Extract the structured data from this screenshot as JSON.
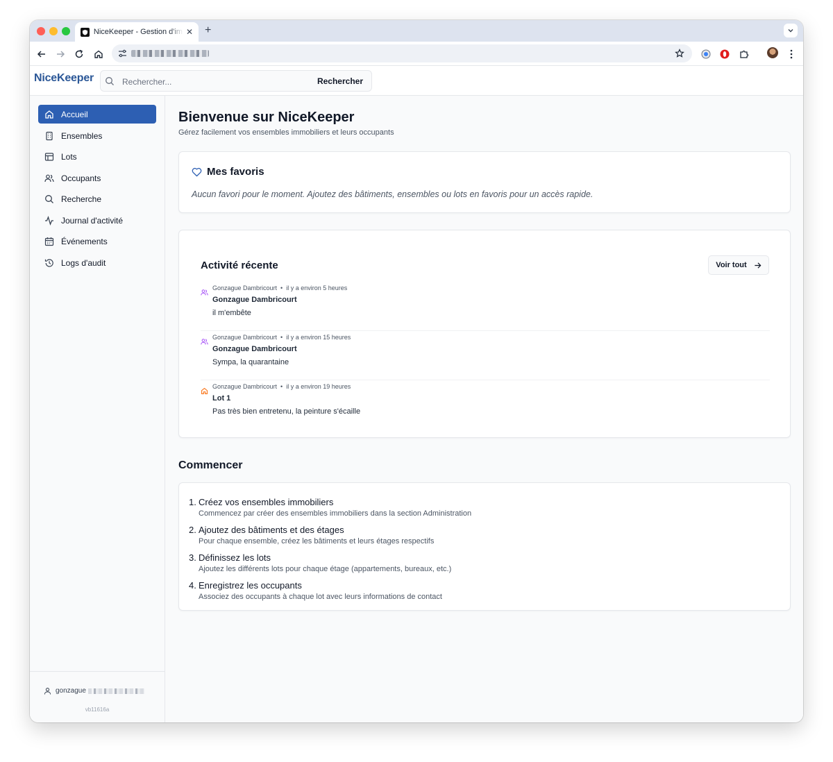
{
  "browser": {
    "tab_title": "NiceKeeper - Gestion d'immeubles",
    "tab_close": "✕",
    "new_tab": "+"
  },
  "app": {
    "brand": "NiceKeeper",
    "search": {
      "placeholder": "Rechercher...",
      "button": "Rechercher"
    }
  },
  "sidebar": {
    "items": [
      {
        "label": "Accueil",
        "icon": "home-icon",
        "active": true
      },
      {
        "label": "Ensembles",
        "icon": "building-icon"
      },
      {
        "label": "Lots",
        "icon": "table-icon"
      },
      {
        "label": "Occupants",
        "icon": "users-icon"
      },
      {
        "label": "Recherche",
        "icon": "search-icon"
      },
      {
        "label": "Journal d'activité",
        "icon": "activity-icon"
      },
      {
        "label": "Événements",
        "icon": "calendar-icon"
      },
      {
        "label": "Logs d'audit",
        "icon": "history-icon"
      }
    ],
    "user": "gonzague",
    "version": "vb11616a"
  },
  "main": {
    "title": "Bienvenue sur NiceKeeper",
    "subtitle": "Gérez facilement vos ensembles immobiliers et leurs occupants",
    "favorites": {
      "title": "Mes favoris",
      "empty": "Aucun favori pour le moment. Ajoutez des bâtiments, ensembles ou lots en favoris pour un accès rapide."
    },
    "activity": {
      "title": "Activité récente",
      "see_all": "Voir tout",
      "items": [
        {
          "author": "Gonzague Dambricourt",
          "time": "il y a environ 5 heures",
          "name": "Gonzague Dambricourt",
          "text": "il m'embête",
          "icon": "users-icon",
          "color": "#a855f7"
        },
        {
          "author": "Gonzague Dambricourt",
          "time": "il y a environ 15 heures",
          "name": "Gonzague Dambricourt",
          "text": "Sympa, la quarantaine",
          "icon": "users-icon",
          "color": "#a855f7"
        },
        {
          "author": "Gonzague Dambricourt",
          "time": "il y a environ 19 heures",
          "name": "Lot 1",
          "text": "Pas très bien entretenu, la peinture s'écaille",
          "icon": "home-icon",
          "color": "#f97316"
        }
      ]
    },
    "start": {
      "title": "Commencer",
      "steps": [
        {
          "num": "1.",
          "title": "Créez vos ensembles immobiliers",
          "desc": "Commencez par créer des ensembles immobiliers dans la section Administration"
        },
        {
          "num": "2.",
          "title": "Ajoutez des bâtiments et des étages",
          "desc": "Pour chaque ensemble, créez les bâtiments et leurs étages respectifs"
        },
        {
          "num": "3.",
          "title": "Définissez les lots",
          "desc": "Ajoutez les différents lots pour chaque étage (appartements, bureaux, etc.)"
        },
        {
          "num": "4.",
          "title": "Enregistrez les occupants",
          "desc": "Associez des occupants à chaque lot avec leurs informations de contact"
        }
      ]
    }
  },
  "colors": {
    "accent": "#2d5fb3",
    "brand": "#2b5797",
    "occupant_icon": "#a855f7",
    "lot_icon": "#f97316"
  }
}
